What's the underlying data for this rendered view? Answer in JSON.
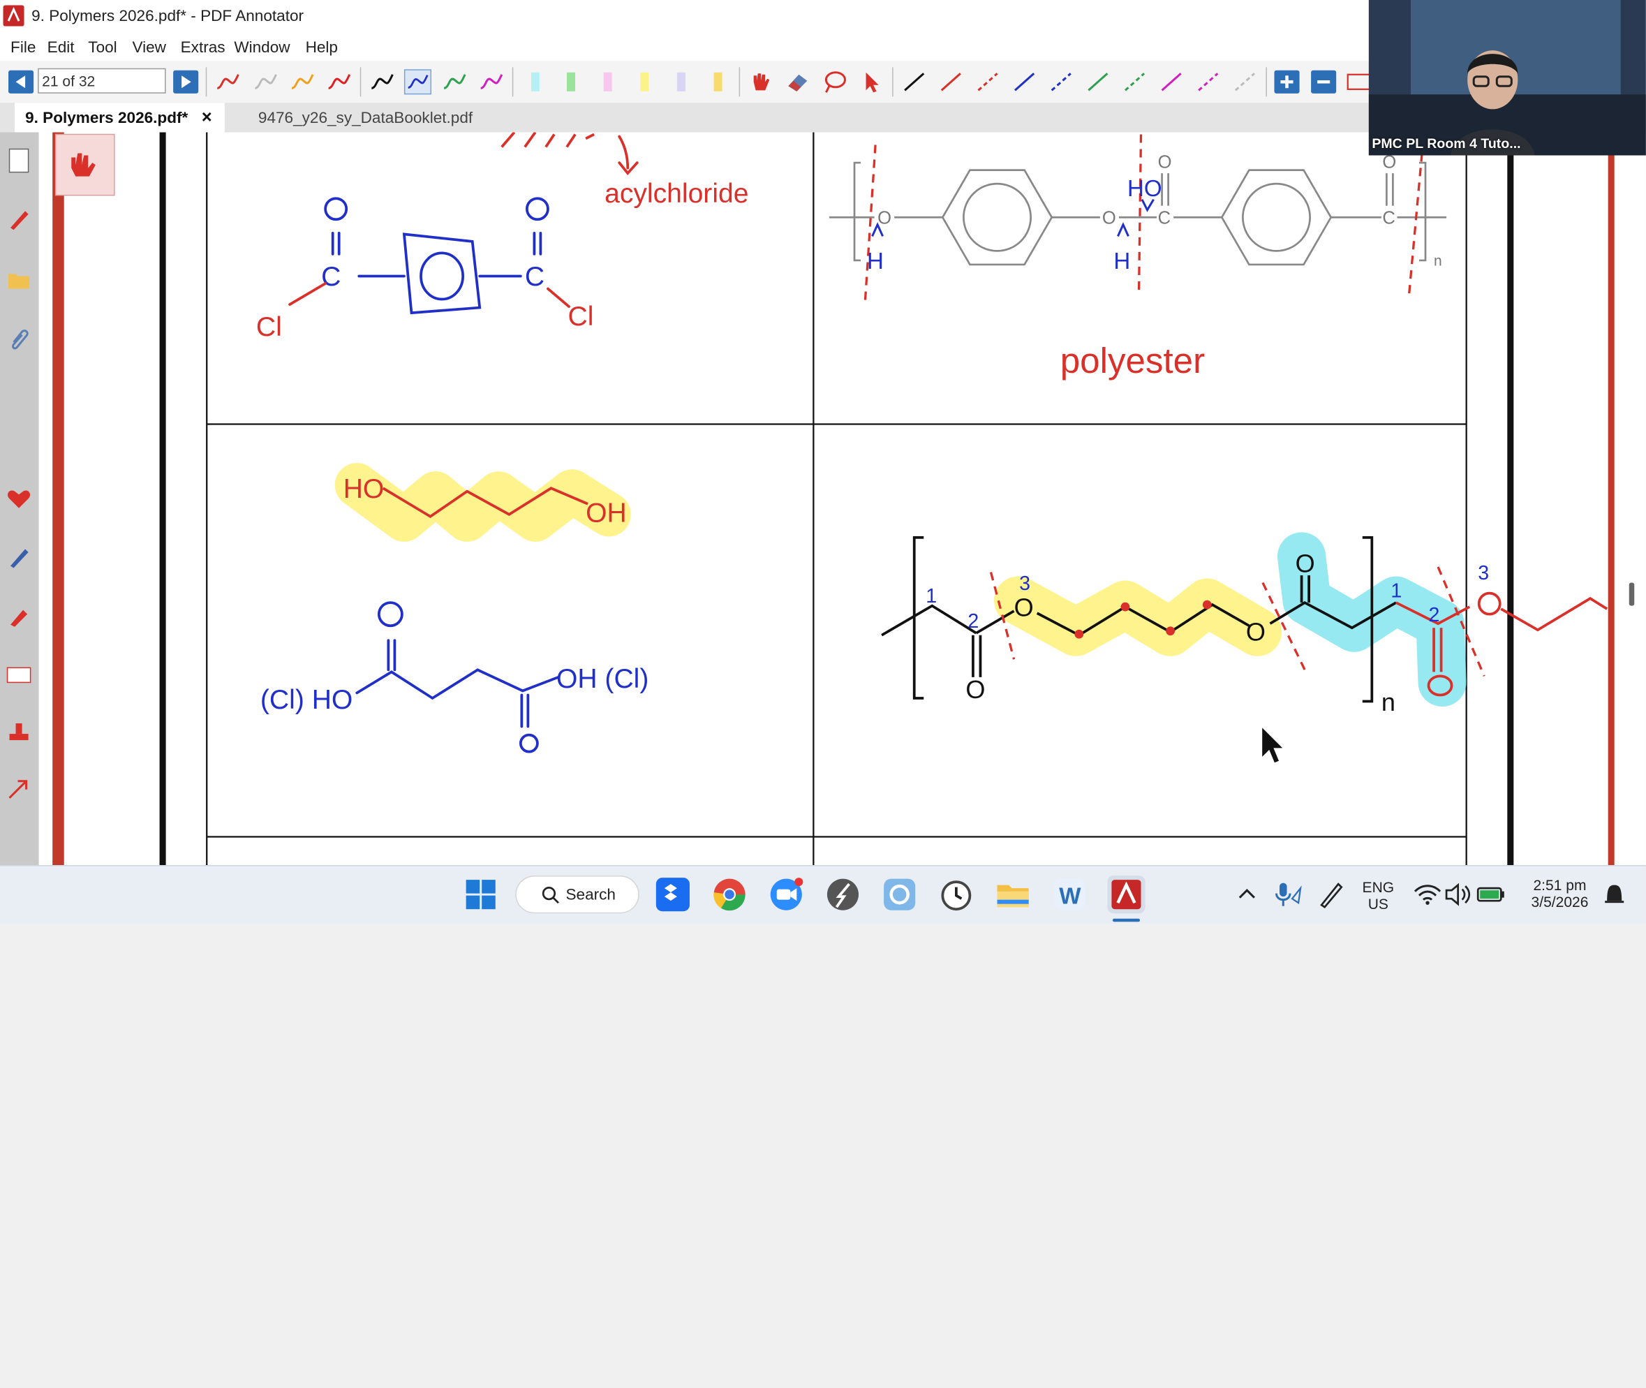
{
  "window": {
    "title": "9. Polymers 2026.pdf* - PDF Annotator"
  },
  "menu": [
    "File",
    "Edit",
    "Tool",
    "View",
    "Extras",
    "Window",
    "Help"
  ],
  "toolbar": {
    "page_indicator": "21 of 32"
  },
  "tabs": [
    {
      "label": "9. Polymers 2026.pdf*",
      "active": true,
      "close": "×"
    },
    {
      "label": "9476_y26_sy_DataBooklet.pdf",
      "active": false
    }
  ],
  "document": {
    "top_left": {
      "annotation": "acylchloride",
      "substituent_left": "Cl",
      "substituent_right": "Cl",
      "carbon_left": "C",
      "carbon_right": "C",
      "oxygen_left": "O",
      "oxygen_right": "O"
    },
    "top_right": {
      "annotation": "polyester",
      "subscript": "n",
      "label_ho": "HO",
      "label_h_left": "H",
      "label_h_mid": "H",
      "atom_o": "O",
      "atom_c": "C"
    },
    "bottom_left": {
      "diol_left": "HO",
      "diol_right": "OH",
      "acid_left": "(Cl) HO",
      "acid_right": "OH (Cl)",
      "acid_o_top": "O",
      "acid_o_bottom": "O"
    },
    "bottom_right": {
      "subscript": "n",
      "numbers": [
        "1",
        "2",
        "3",
        "1",
        "2",
        "3"
      ],
      "atom_o": "O"
    }
  },
  "video": {
    "participant_name": "PMC PL Room 4 Tuto..."
  },
  "taskbar": {
    "search_label": "Search",
    "language_top": "ENG",
    "language_bottom": "US",
    "time": "2:51 pm",
    "date": "3/5/2026"
  },
  "colors": {
    "accent": "#2d6fb6",
    "annotation_red": "#d9302a",
    "annotation_blue": "#1f2fc8",
    "highlight_yellow": "#fff17a",
    "highlight_cyan": "#7de3ee"
  }
}
